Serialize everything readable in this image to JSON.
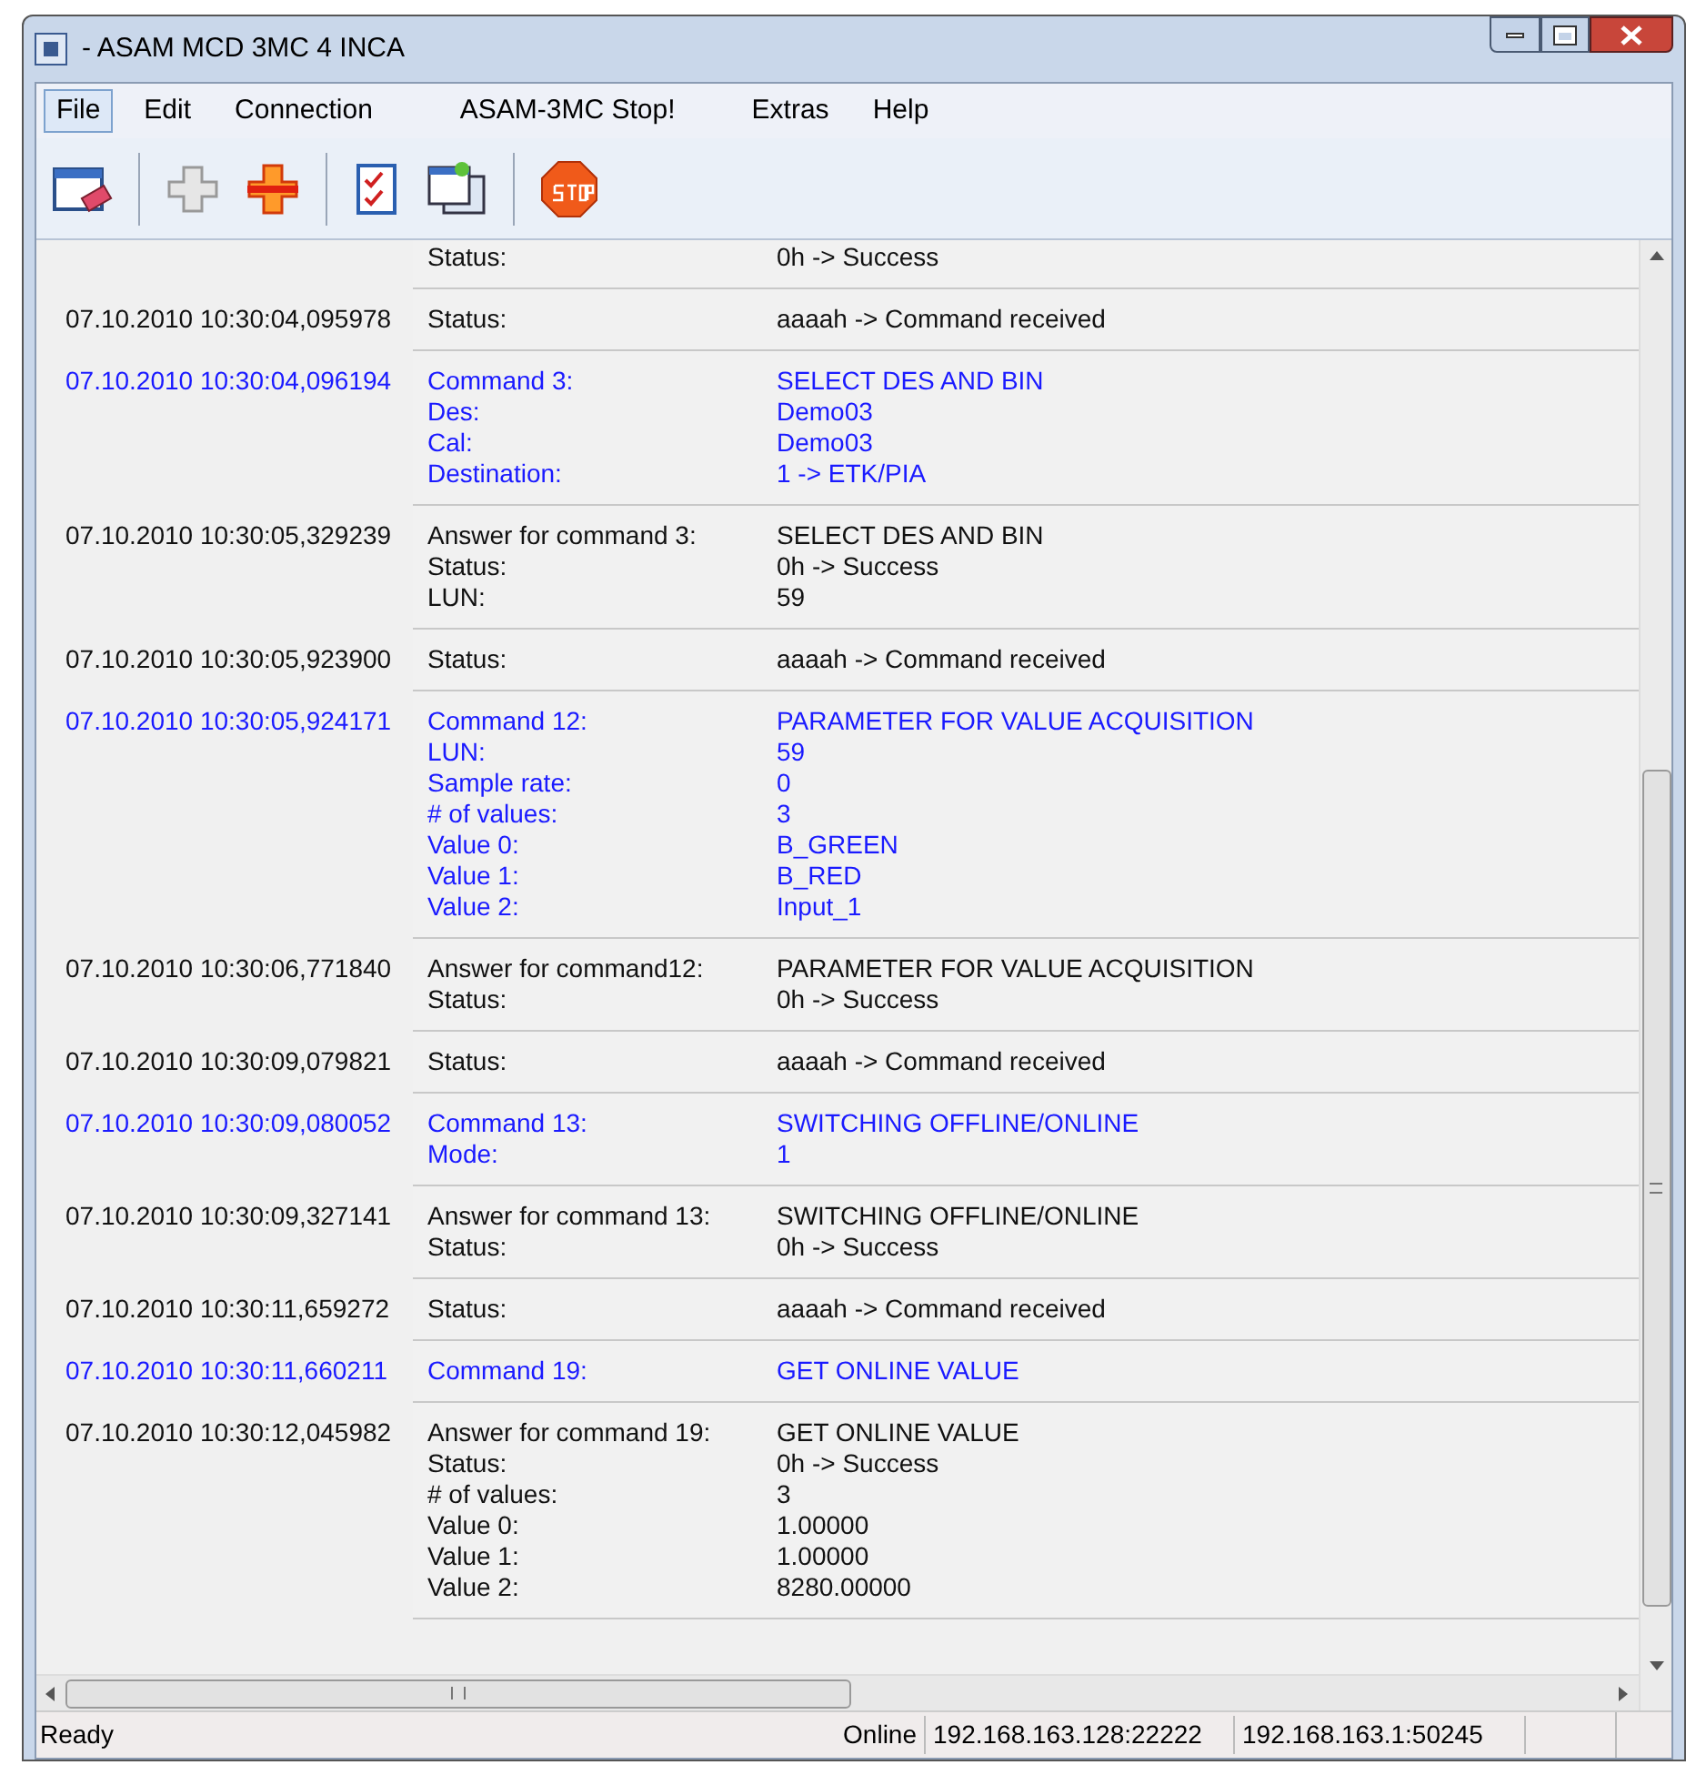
{
  "window": {
    "title": "- ASAM MCD 3MC 4 INCA"
  },
  "menu": [
    {
      "label": "File",
      "selected": true
    },
    {
      "label": "Edit",
      "selected": false
    },
    {
      "label": "Connection",
      "selected": false
    },
    {
      "label": "ASAM-3MC Stop!",
      "selected": false
    },
    {
      "label": "Extras",
      "selected": false
    },
    {
      "label": "Help",
      "selected": false
    }
  ],
  "log": [
    {
      "kind": "answer",
      "lines": [
        {
          "label": "Status:",
          "value": "0h -> Success"
        }
      ]
    },
    {
      "kind": "answer",
      "time": "07.10.2010 10:30:04,095978",
      "lines": [
        {
          "label": "Status:",
          "value": "aaaah -> Command received"
        }
      ]
    },
    {
      "kind": "command",
      "time": "07.10.2010 10:30:04,096194",
      "lines": [
        {
          "label": "Command 3:",
          "value": "SELECT DES AND BIN"
        },
        {
          "label": "Des:",
          "value": "Demo03"
        },
        {
          "label": "Cal:",
          "value": "Demo03"
        },
        {
          "label": "Destination:",
          "value": "1 -> ETK/PIA"
        }
      ]
    },
    {
      "kind": "answer",
      "time": "07.10.2010 10:30:05,329239",
      "lines": [
        {
          "label": "Answer for command 3:",
          "value": "SELECT DES AND BIN"
        },
        {
          "label": "Status:",
          "value": "0h -> Success"
        },
        {
          "label": "LUN:",
          "value": "59"
        }
      ]
    },
    {
      "kind": "answer",
      "time": "07.10.2010 10:30:05,923900",
      "lines": [
        {
          "label": "Status:",
          "value": "aaaah -> Command received"
        }
      ]
    },
    {
      "kind": "command",
      "time": "07.10.2010 10:30:05,924171",
      "lines": [
        {
          "label": "Command 12:",
          "value": "PARAMETER FOR VALUE ACQUISITION"
        },
        {
          "label": "LUN:",
          "value": "59"
        },
        {
          "label": "Sample rate:",
          "value": "0"
        },
        {
          "label": "# of values:",
          "value": "3"
        },
        {
          "label": "Value 0:",
          "value": "B_GREEN"
        },
        {
          "label": "Value 1:",
          "value": "B_RED"
        },
        {
          "label": "Value 2:",
          "value": "Input_1"
        }
      ]
    },
    {
      "kind": "answer",
      "time": "07.10.2010 10:30:06,771840",
      "lines": [
        {
          "label": "Answer for command12:",
          "value": "PARAMETER FOR VALUE ACQUISITION"
        },
        {
          "label": "Status:",
          "value": "0h -> Success"
        }
      ]
    },
    {
      "kind": "answer",
      "time": "07.10.2010 10:30:09,079821",
      "lines": [
        {
          "label": "Status:",
          "value": "aaaah -> Command received"
        }
      ]
    },
    {
      "kind": "command",
      "time": "07.10.2010 10:30:09,080052",
      "lines": [
        {
          "label": "Command 13:",
          "value": "SWITCHING OFFLINE/ONLINE"
        },
        {
          "label": "Mode:",
          "value": "1"
        }
      ]
    },
    {
      "kind": "answer",
      "time": "07.10.2010 10:30:09,327141",
      "lines": [
        {
          "label": "Answer for command 13:",
          "value": "SWITCHING OFFLINE/ONLINE"
        },
        {
          "label": "Status:",
          "value": "0h -> Success"
        }
      ]
    },
    {
      "kind": "answer",
      "time": "07.10.2010 10:30:11,659272",
      "lines": [
        {
          "label": "Status:",
          "value": "aaaah -> Command received"
        }
      ]
    },
    {
      "kind": "command",
      "time": "07.10.2010 10:30:11,660211",
      "lines": [
        {
          "label": "Command 19:",
          "value": "GET ONLINE VALUE"
        }
      ]
    },
    {
      "kind": "answer",
      "time": "07.10.2010 10:30:12,045982",
      "lines": [
        {
          "label": "Answer for command 19:",
          "value": "GET ONLINE VALUE"
        },
        {
          "label": "Status:",
          "value": "0h -> Success"
        },
        {
          "label": "# of values:",
          "value": "3"
        },
        {
          "label": "Value 0:",
          "value": "1.00000"
        },
        {
          "label": "Value 1:",
          "value": "1.00000"
        },
        {
          "label": "Value 2:",
          "value": "8280.00000"
        }
      ]
    }
  ],
  "status_bar": {
    "message": "Ready",
    "state": "Online",
    "local": "192.168.163.128:22222",
    "remote": "192.168.163.1:50245"
  }
}
